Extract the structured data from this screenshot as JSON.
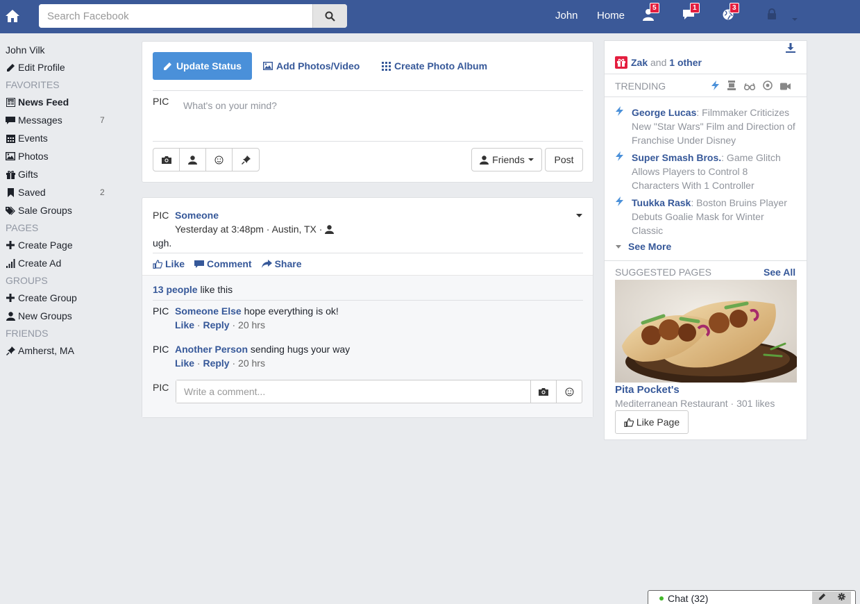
{
  "header": {
    "search_placeholder": "Search Facebook",
    "user_name": "John",
    "home_label": "Home",
    "friend_requests_count": "5",
    "messages_count": "1",
    "notifications_count": "3",
    "bar_color": "#3b5998"
  },
  "sidebar": {
    "user_name": "John Vilk",
    "edit_profile": "Edit Profile",
    "favorites_head": "FAVORITES",
    "news_feed": "News Feed",
    "messages": "Messages",
    "messages_count": "7",
    "events": "Events",
    "photos": "Photos",
    "gifts": "Gifts",
    "saved": "Saved",
    "saved_count": "2",
    "sale_groups": "Sale Groups",
    "pages_head": "PAGES",
    "create_page": "Create Page",
    "create_ad": "Create Ad",
    "groups_head": "GROUPS",
    "create_group": "Create Group",
    "new_groups": "New Groups",
    "friends_head": "FRIENDS",
    "location": "Amherst, MA"
  },
  "composer": {
    "update_status": "Update Status",
    "add_photos": "Add Photos/Video",
    "create_album": "Create Photo Album",
    "pic": "PIC",
    "placeholder": "What's on your mind?",
    "audience": "Friends",
    "post_label": "Post"
  },
  "post": {
    "pic": "PIC",
    "author": "Someone",
    "meta": "Yesterday at 3:48pm · Austin, TX ·",
    "text": "ugh.",
    "like": "Like",
    "comment": "Comment",
    "share": "Share",
    "likes_count_link": "13 people",
    "likes_suffix": " like this",
    "comments": [
      {
        "pic": "PIC",
        "author": "Someone Else",
        "text": " hope everything is ok!",
        "like": "Like",
        "reply": "Reply",
        "time": " · 20 hrs"
      },
      {
        "pic": "PIC",
        "author": "Another Person",
        "text": " sending hugs your way",
        "like": "Like",
        "reply": "Reply",
        "time": " · 20 hrs"
      }
    ],
    "write_pic": "PIC",
    "write_placeholder": "Write a comment..."
  },
  "right": {
    "birthday_name": "Zak",
    "birthday_and": " and ",
    "birthday_other": "1 other",
    "trending_head": "TRENDING",
    "trends": [
      {
        "title": "George Lucas",
        "text": ": Filmmaker Criticizes New \"Star Wars\" Film and Direction of Franchise Under Disney"
      },
      {
        "title": "Super Smash Bros.",
        "text": ": Game Glitch Allows Players to Control 8 Characters With 1 Controller"
      },
      {
        "title": "Tuukka Rask",
        "text": ": Boston Bruins Player Debuts Goalie Mask for Winter Classic"
      }
    ],
    "see_more": "See More",
    "suggested_head": "SUGGESTED PAGES",
    "see_all": "See All",
    "page_name": "Pita Pocket's",
    "page_meta": "Mediterranean Restaurant · 301 likes",
    "like_page": "Like Page"
  },
  "chat": {
    "label": "Chat (32)"
  }
}
